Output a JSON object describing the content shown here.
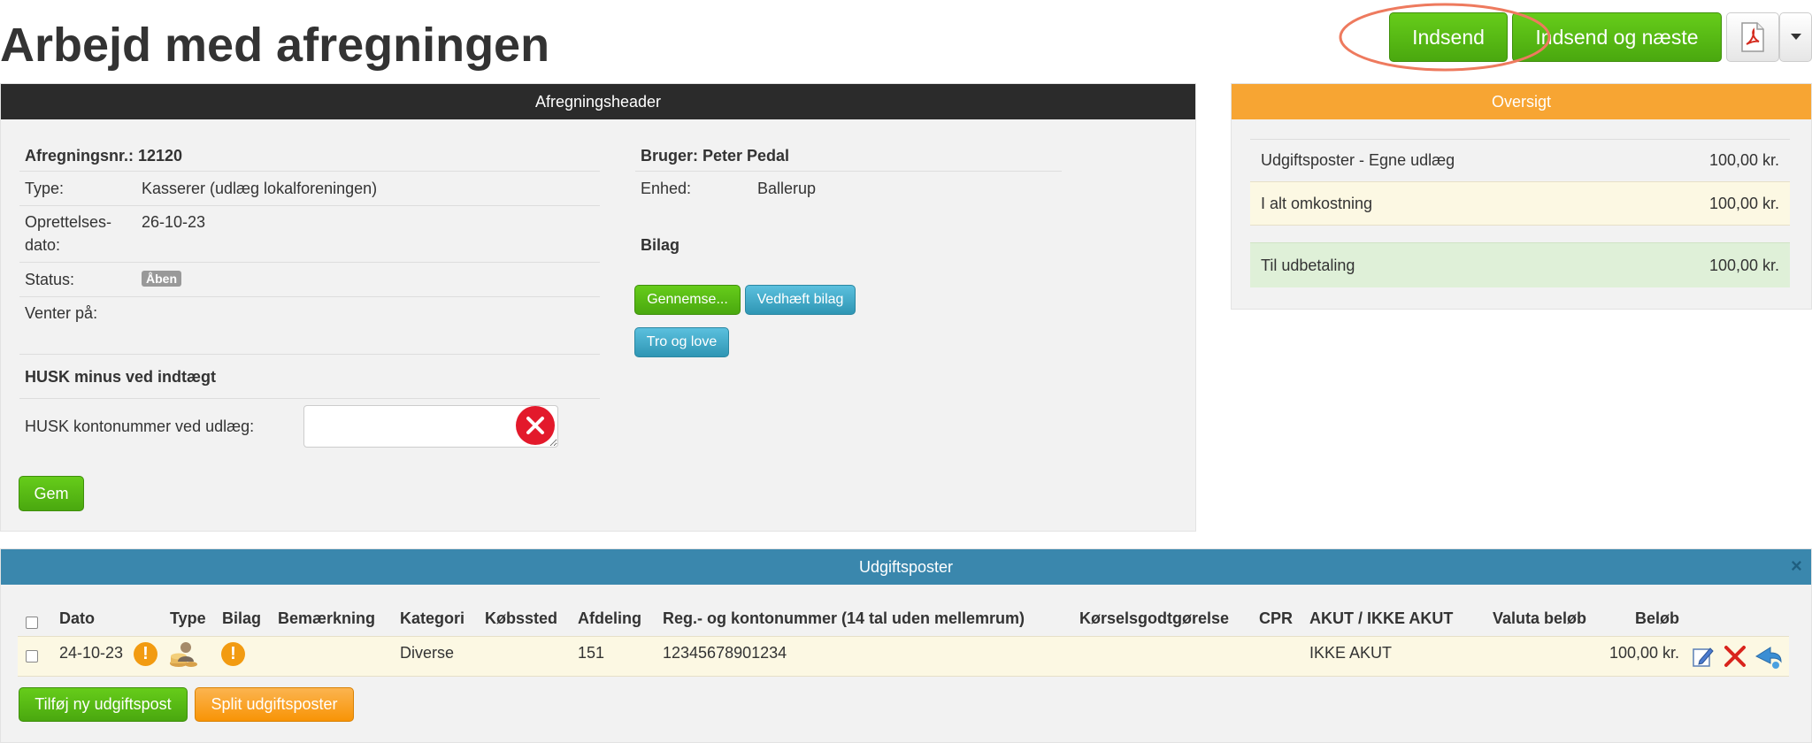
{
  "page": {
    "title": "Arbejd med afregningen"
  },
  "toolbar": {
    "submit_label": "Indsend",
    "submit_next_label": "Indsend og næste"
  },
  "header_panel": {
    "title": "Afregningsheader",
    "number_label": "Afregningsnr.: 12120",
    "type_label": "Type:",
    "type_value": "Kasserer (udlæg lokalforeningen)",
    "created_label_1": "Oprettelses-",
    "created_label_2": "dato:",
    "created_value": "26-10-23",
    "status_label": "Status:",
    "status_value": "Åben",
    "waiting_label": "Venter på:",
    "husk_heading": "HUSK minus ved indtægt",
    "account_label": "HUSK kontonummer ved udlæg:",
    "account_value": "",
    "save_label": "Gem",
    "user_label": "Bruger: Peter Pedal",
    "unit_label": "Enhed:",
    "unit_value": "Ballerup",
    "bilag_heading": "Bilag",
    "browse_label": "Gennemse...",
    "attach_label": "Vedhæft bilag",
    "faith_label": "Tro og love"
  },
  "overview": {
    "title": "Oversigt",
    "rows": [
      {
        "label": "Udgiftsposter - Egne udlæg",
        "value": "100,00 kr."
      },
      {
        "label": "I alt omkostning",
        "value": "100,00 kr."
      },
      {
        "label": "Til udbetaling",
        "value": "100,00 kr."
      }
    ]
  },
  "expenses": {
    "title": "Udgiftsposter",
    "close_symbol": "×",
    "columns": [
      "Dato",
      "Type",
      "Bilag",
      "Bemærkning",
      "Kategori",
      "Købssted",
      "Afdeling",
      "Reg.- og kontonummer (14 tal uden mellemrum)",
      "Kørselsgodtgørelse",
      "CPR",
      "AKUT / IKKE AKUT",
      "Valuta beløb",
      "Beløb"
    ],
    "rows": [
      {
        "date": "24-10-23",
        "remark": "",
        "category": "Diverse",
        "shop": "",
        "department": "151",
        "account": "12345678901234",
        "mileage": "",
        "cpr": "",
        "urgency": "IKKE AKUT",
        "currency_amount": "",
        "amount": "100,00 kr."
      }
    ],
    "add_label": "Tilføj ny udgiftspost",
    "split_label": "Split udgiftsposter"
  },
  "colors": {
    "green": "#55b011",
    "blue_header": "#3a87ad",
    "dark_header": "#2b2b2b",
    "orange_header": "#f7a533",
    "annotation_circle": "#ee7a5e"
  }
}
